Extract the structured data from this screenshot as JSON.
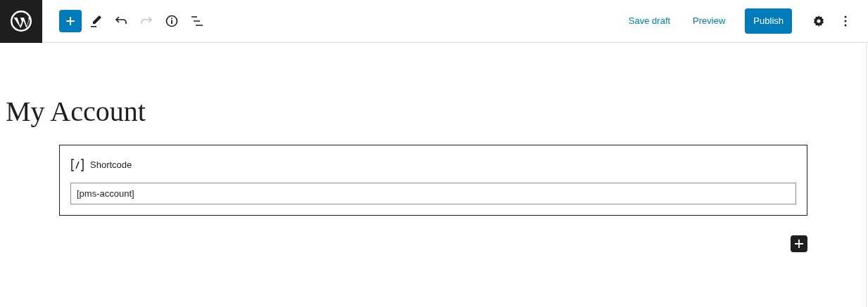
{
  "toolbar": {
    "tools": [
      {
        "kind": "inserter",
        "disabled": false
      },
      {
        "kind": "pencil",
        "disabled": false
      },
      {
        "kind": "undo",
        "disabled": false
      },
      {
        "kind": "redo",
        "disabled": true
      },
      {
        "kind": "info",
        "disabled": false
      },
      {
        "kind": "outline",
        "disabled": false
      }
    ],
    "save_draft": "Save draft",
    "preview": "Preview",
    "publish": "Publish"
  },
  "post": {
    "title": "My Account",
    "block": {
      "label": "Shortcode",
      "value": "[pms-account]"
    }
  }
}
